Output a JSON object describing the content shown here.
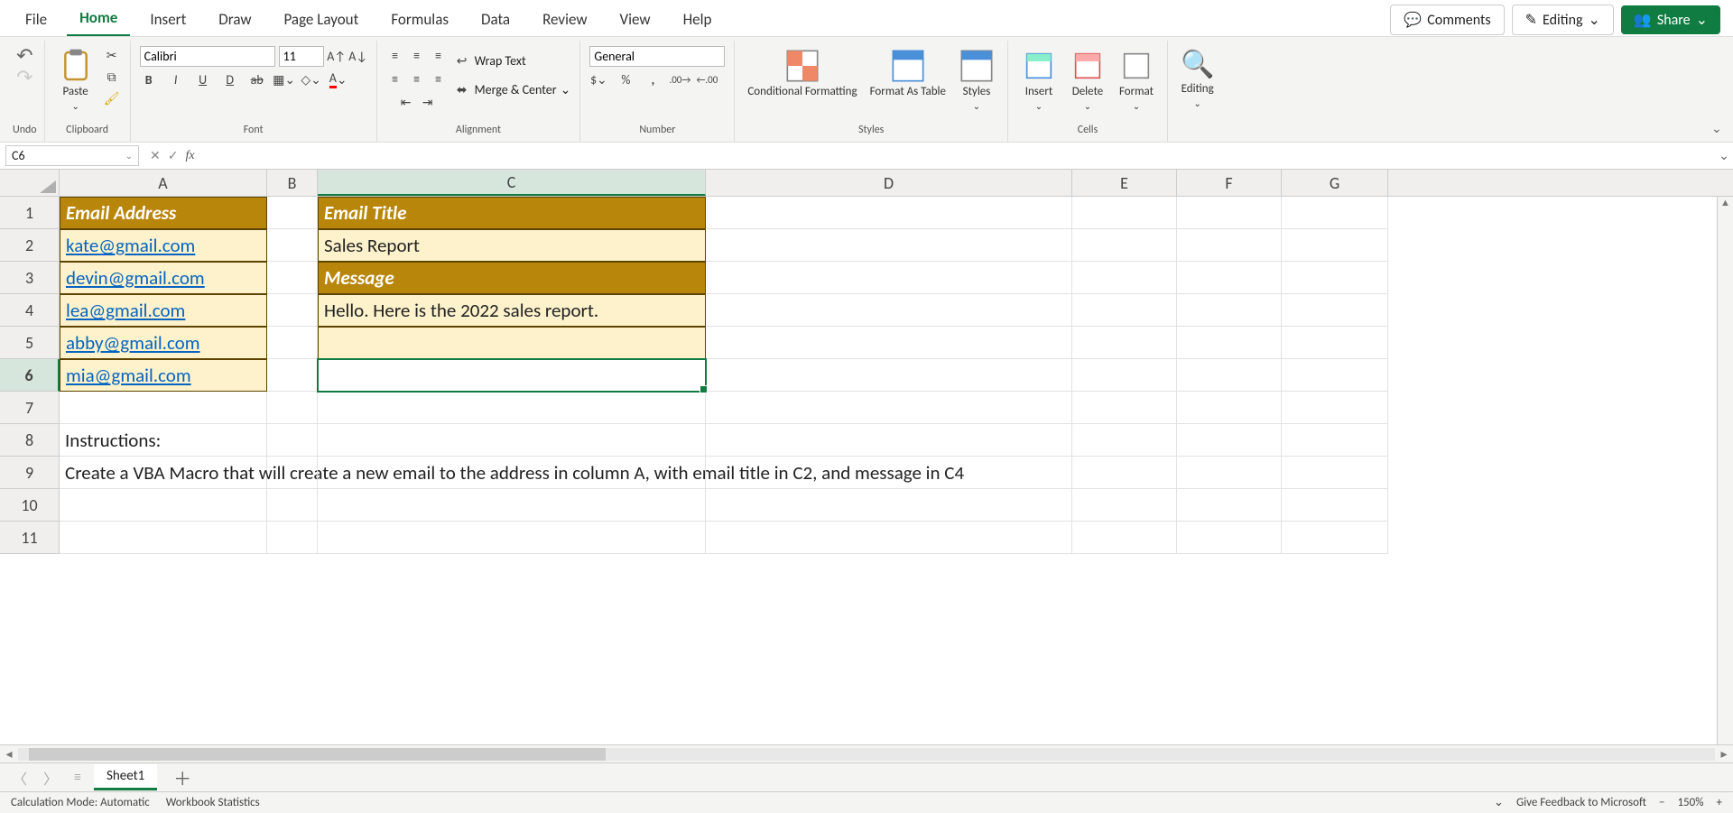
{
  "tabs": [
    "File",
    "Home",
    "Insert",
    "Draw",
    "Page Layout",
    "Formulas",
    "Data",
    "Review",
    "View",
    "Help"
  ],
  "active_tab": "Home",
  "top_buttons": {
    "comments": "Comments",
    "editing": "Editing",
    "share": "Share"
  },
  "ribbon": {
    "undo": "Undo",
    "clipboard": {
      "paste": "Paste",
      "label": "Clipboard"
    },
    "font": {
      "name": "Calibri",
      "size": "11",
      "label": "Font",
      "bold": "B",
      "italic": "I",
      "underline": "U"
    },
    "alignment": {
      "wrap": "Wrap Text",
      "merge": "Merge & Center",
      "label": "Alignment"
    },
    "number": {
      "format": "General",
      "label": "Number"
    },
    "styles": {
      "cond": "Conditional Formatting",
      "fmttbl": "Format As Table",
      "styles": "Styles",
      "label": "Styles"
    },
    "cells": {
      "insert": "Insert",
      "delete": "Delete",
      "format": "Format",
      "label": "Cells"
    },
    "editing": {
      "edit": "Editing"
    }
  },
  "name_box": "C6",
  "formula": "",
  "columns": [
    "A",
    "B",
    "C",
    "D",
    "E",
    "F",
    "G"
  ],
  "col_widths": [
    "wA",
    "wB",
    "wC",
    "wD",
    "wE",
    "wF",
    "wG"
  ],
  "active_col": "C",
  "rows": [
    "1",
    "2",
    "3",
    "4",
    "5",
    "6",
    "7",
    "8",
    "9",
    "10",
    "11"
  ],
  "active_row": "6",
  "cells": {
    "A1": {
      "v": "Email Address",
      "cls": "hdr-cell"
    },
    "A2": {
      "v": "kate@gmail.com",
      "cls": "data-cell link"
    },
    "A3": {
      "v": "devin@gmail.com",
      "cls": "data-cell link"
    },
    "A4": {
      "v": "lea@gmail.com",
      "cls": "data-cell link"
    },
    "A5": {
      "v": "abby@gmail.com",
      "cls": "data-cell link"
    },
    "A6": {
      "v": "mia@gmail.com",
      "cls": "data-cell link"
    },
    "C1": {
      "v": "Email Title",
      "cls": "hdr-cell"
    },
    "C2": {
      "v": "Sales Report",
      "cls": "data-cell"
    },
    "C3": {
      "v": "Message",
      "cls": "hdr-cell"
    },
    "C4": {
      "v": "Hello. Here is the 2022 sales report.",
      "cls": "data-cell"
    },
    "C5": {
      "v": "",
      "cls": "data-cell"
    },
    "A8": {
      "v": "Instructions:",
      "cls": ""
    },
    "A9": {
      "v": "Create a VBA Macro that will create a new email to the address in column A, with email title in C2, and message in C4",
      "cls": ""
    }
  },
  "selected_cell": "C6",
  "sheet": {
    "name": "Sheet1"
  },
  "status": {
    "calc": "Calculation Mode: Automatic",
    "stats": "Workbook Statistics",
    "feedback": "Give Feedback to Microsoft",
    "zoom": "150%"
  }
}
